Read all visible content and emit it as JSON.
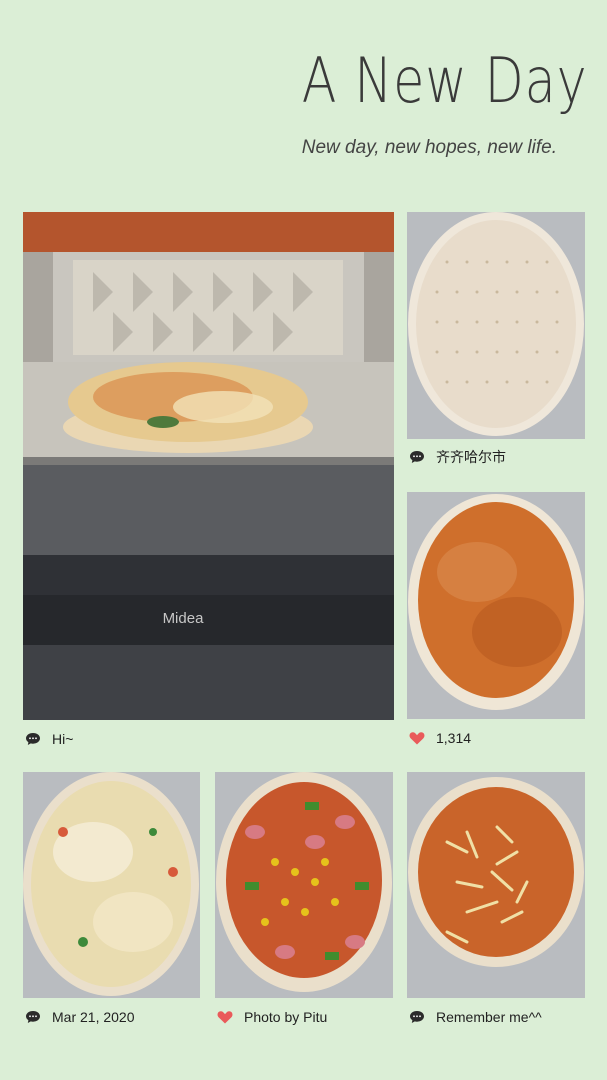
{
  "header": {
    "title": "A New Day",
    "subtitle": "New day, new hopes, new life."
  },
  "photos": [
    {
      "description_icon": "oven-pizza-photo",
      "brand": "Midea",
      "caption": "Hi~",
      "caption_icon": "comment-icon"
    },
    {
      "description_icon": "pizza-dough-photo",
      "caption": "齐齐哈尔市",
      "caption_icon": "comment-icon"
    },
    {
      "description_icon": "pizza-sauce-photo",
      "caption": "1,314",
      "caption_icon": "heart-icon"
    },
    {
      "description_icon": "pizza-cheese-photo",
      "caption": "Mar 21, 2020",
      "caption_icon": "comment-icon"
    },
    {
      "description_icon": "pizza-toppings-photo",
      "caption": "Photo by Pitu",
      "caption_icon": "heart-icon"
    },
    {
      "description_icon": "pizza-sauce-cheese-photo",
      "caption": "Remember me^^",
      "caption_icon": "comment-icon"
    }
  ],
  "colors": {
    "background": "#dbeed6",
    "heart": "#e95a5a",
    "comment": "#2b2b2b"
  }
}
